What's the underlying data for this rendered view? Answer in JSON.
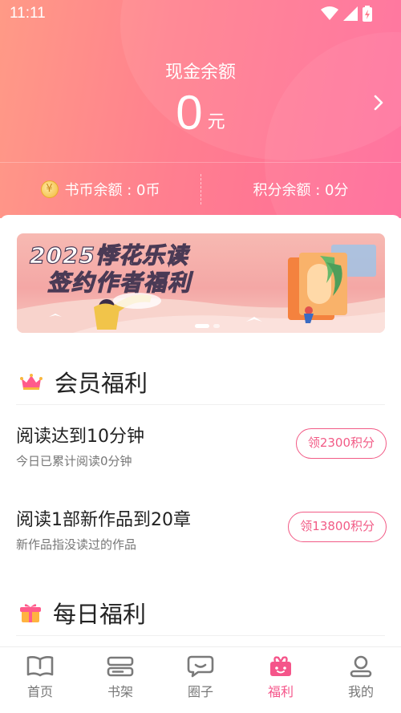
{
  "status": {
    "time": "11:11"
  },
  "wallet": {
    "cash_title": "现金余额",
    "cash_amount": "0",
    "cash_unit": "元",
    "coin_label": "书币余额 : 0币",
    "coin_symbol": "¥",
    "points_label": "积分余额 : 0分"
  },
  "banner": {
    "line1": "2025悸花乐读",
    "line2": "签约作者福利"
  },
  "member_section": {
    "title": "会员福利",
    "tasks": [
      {
        "title": "阅读达到10分钟",
        "subtitle": "今日已累计阅读0分钟",
        "button": "领2300积分"
      },
      {
        "title": "阅读1部新作品到20章",
        "subtitle": "新作品指没读过的作品",
        "button": "领13800积分"
      }
    ]
  },
  "daily_section": {
    "title": "每日福利"
  },
  "tabbar": {
    "items": [
      {
        "label": "首页",
        "icon": "book-open-icon"
      },
      {
        "label": "书架",
        "icon": "bookshelf-icon"
      },
      {
        "label": "圈子",
        "icon": "chat-bubble-icon"
      },
      {
        "label": "福利",
        "icon": "gift-box-icon",
        "active": true
      },
      {
        "label": "我的",
        "icon": "profile-icon"
      }
    ]
  },
  "colors": {
    "accent": "#f5558a",
    "header_start": "#ff9a86",
    "header_end": "#ff6b9a"
  }
}
